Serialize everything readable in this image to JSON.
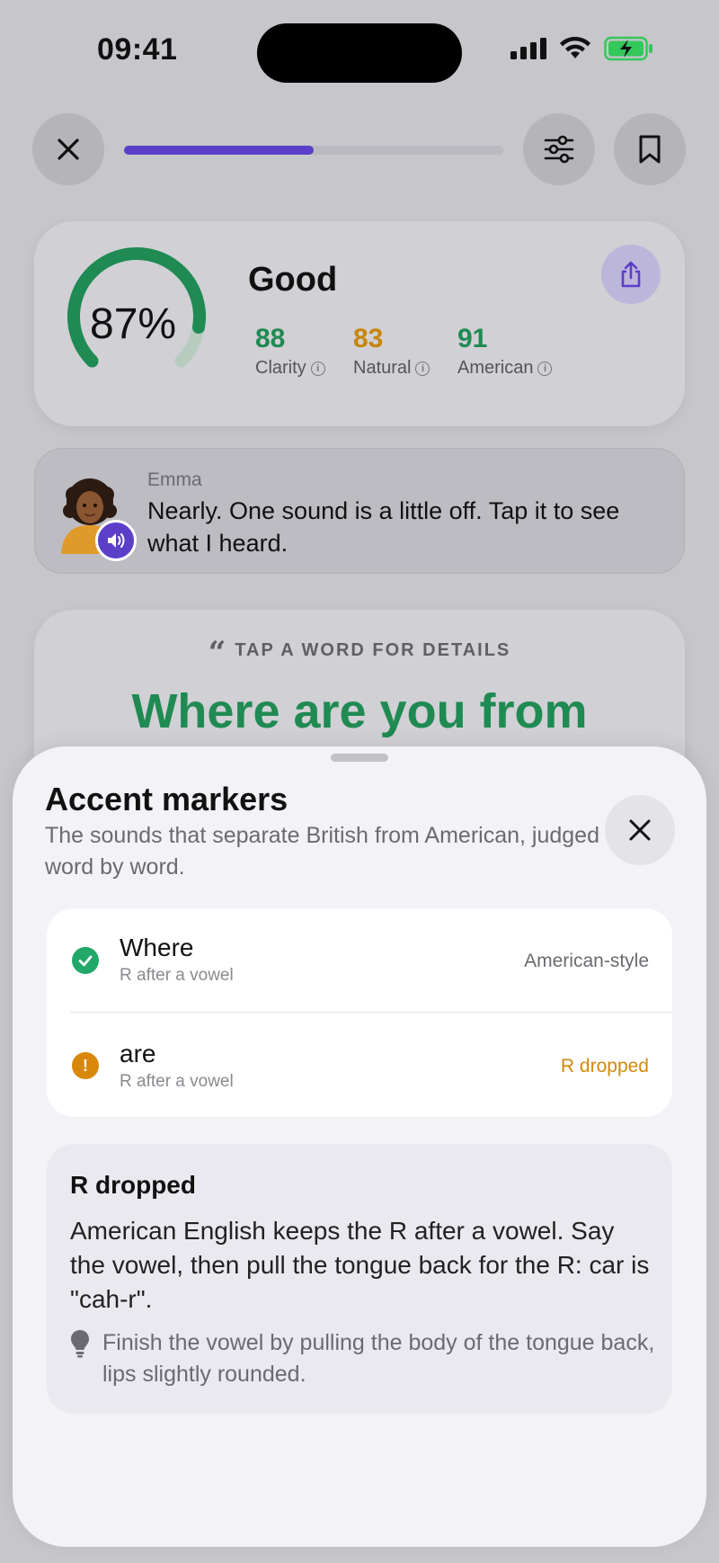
{
  "status_bar": {
    "time": "09:41"
  },
  "top_bar": {
    "progress_fraction": 0.5
  },
  "score": {
    "percent": "87%",
    "percent_value": 87,
    "grade": "Good",
    "metrics": [
      {
        "value": "88",
        "label": "Clarity",
        "color": "#1f8a52"
      },
      {
        "value": "83",
        "label": "Natural",
        "color": "#c8860a"
      },
      {
        "value": "91",
        "label": "American",
        "color": "#1f8a52"
      }
    ]
  },
  "coach": {
    "name": "Emma",
    "message": "Nearly. One sound is a little off. Tap it to see what I heard."
  },
  "sentence_card": {
    "hint": "TAP A WORD FOR DETAILS",
    "sentence": "Where are you from"
  },
  "sheet": {
    "title": "Accent markers",
    "subtitle": "The sounds that separate British from American, judged word by word.",
    "rows": [
      {
        "word": "Where",
        "sub": "R after a vowel",
        "status": "American-style",
        "state": "good",
        "status_color": "#6a6a70",
        "icon_color": "#22a868"
      },
      {
        "word": "are",
        "sub": "R after a vowel",
        "status": "R dropped",
        "state": "warn",
        "status_color": "#d08a0c",
        "icon_color": "#d9870a"
      }
    ],
    "detail": {
      "title": "R dropped",
      "body": "American English keeps the R after a vowel. Say the vowel, then pull the tongue back for the R: car is \"cah-r\".",
      "tip": "Finish the vowel by pulling the body of the tongue back, lips slightly rounded."
    }
  },
  "colors": {
    "accent": "#5b3fc8",
    "good": "#1f8a52",
    "warn": "#d08a0c"
  }
}
